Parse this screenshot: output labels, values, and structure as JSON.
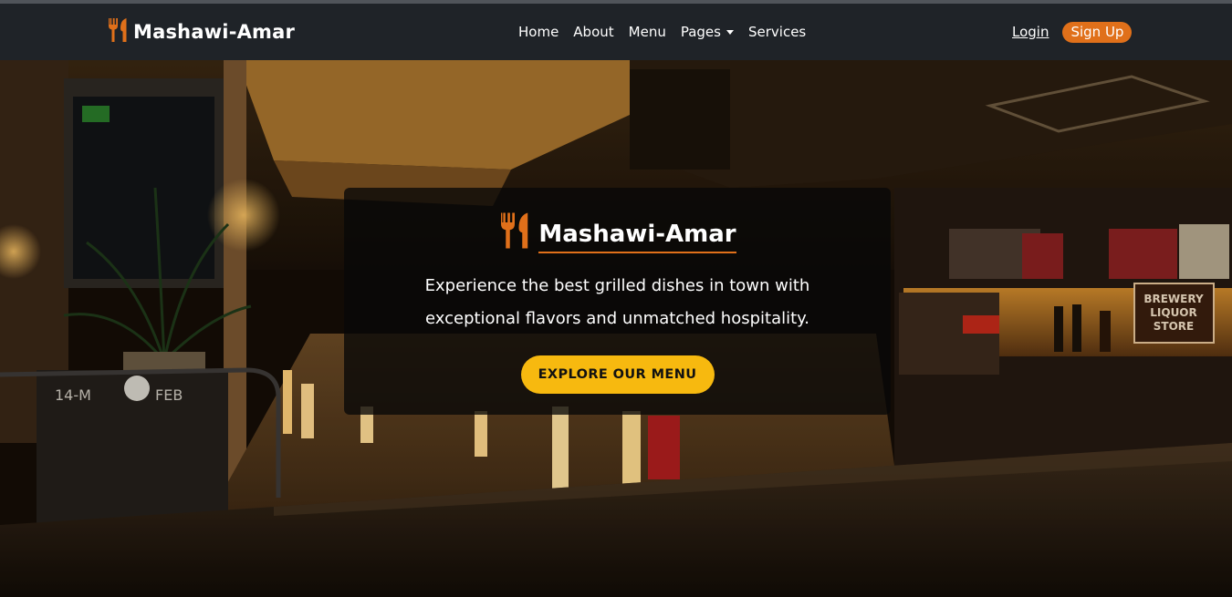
{
  "brand": {
    "name": "Mashawi-Amar",
    "icon": "utensils-icon",
    "color": "#e0701a"
  },
  "nav": {
    "items": [
      {
        "label": "Home"
      },
      {
        "label": "About"
      },
      {
        "label": "Menu"
      },
      {
        "label": "Pages",
        "has_dropdown": true
      },
      {
        "label": "Services"
      }
    ]
  },
  "auth": {
    "login_label": "Login",
    "signup_label": "Sign Up"
  },
  "hero": {
    "background": "restaurant-interior-photo",
    "title": "Mashawi-Amar",
    "tagline": "Experience the best grilled dishes in town with exceptional flavors and unmatched hospitality.",
    "cta_label": "EXPLORE OUR MENU",
    "cta_color": "#f7b90f"
  }
}
